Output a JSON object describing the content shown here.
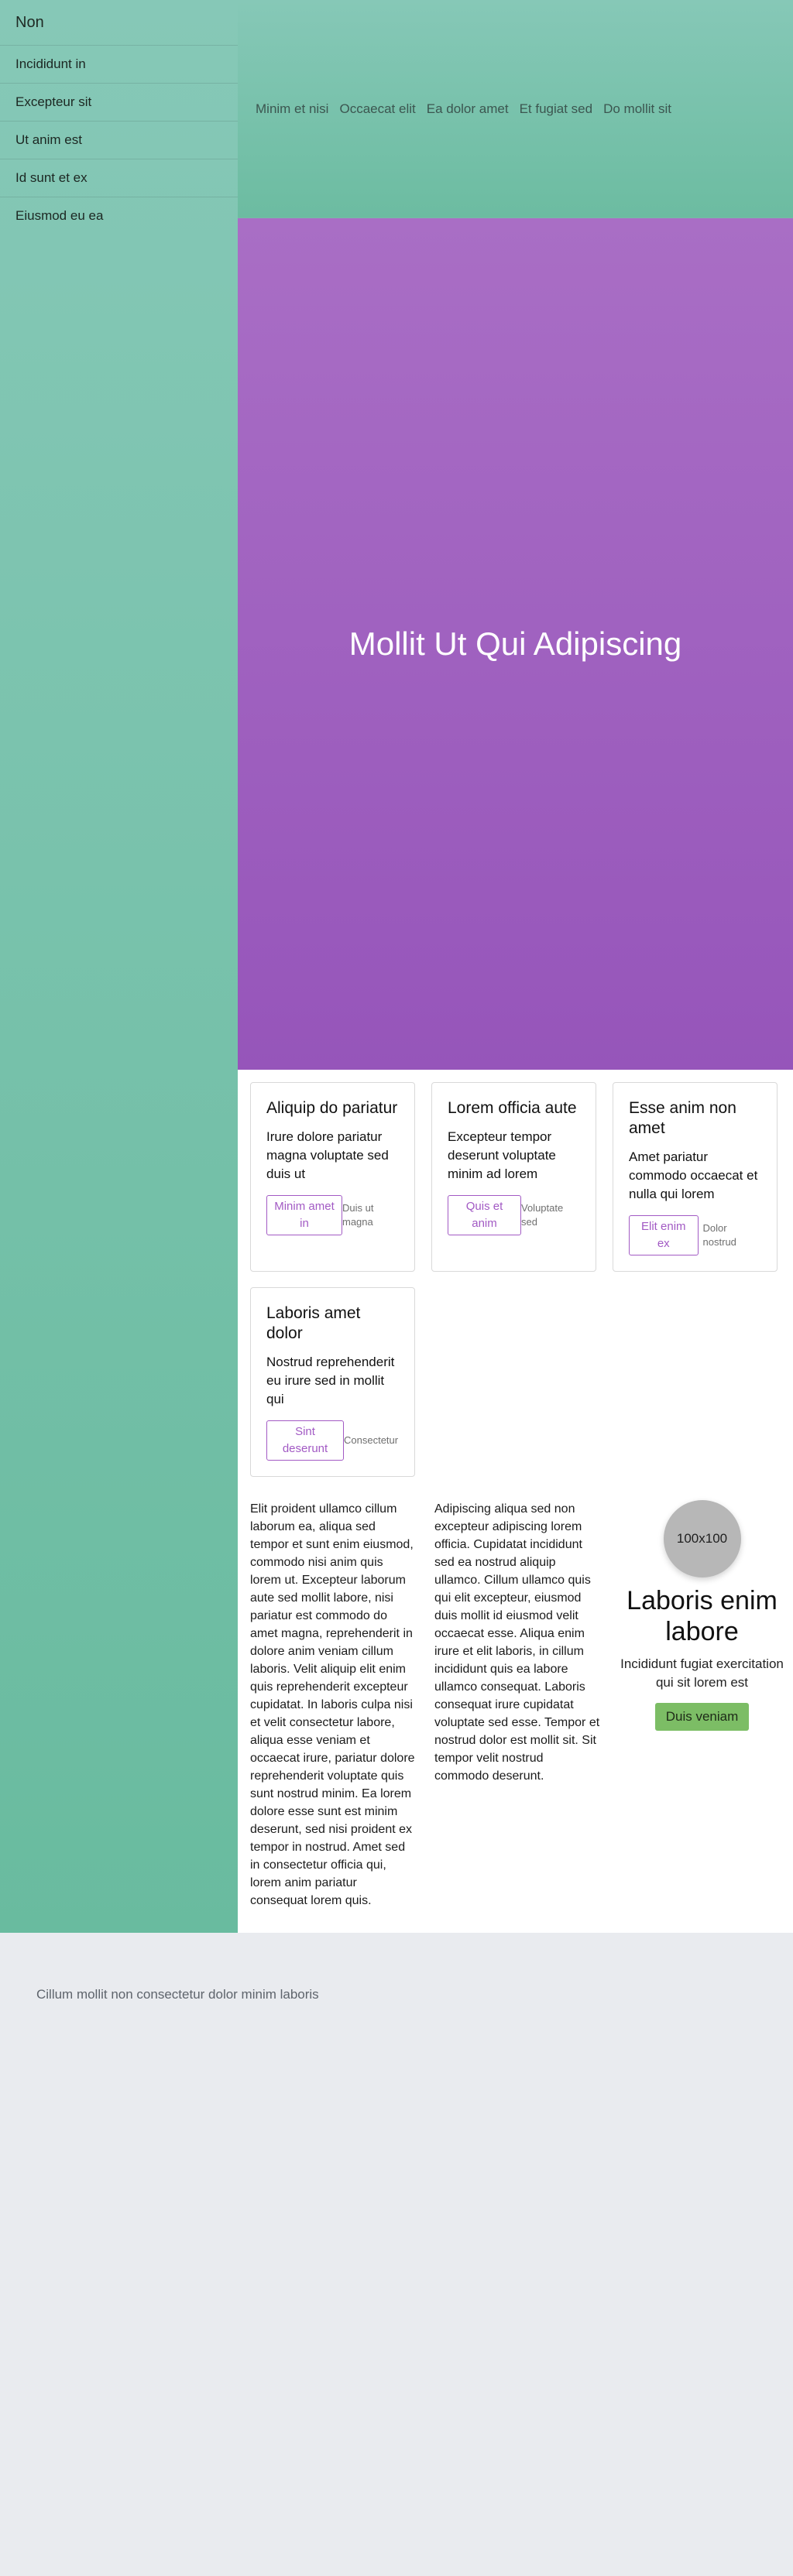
{
  "sidebar": {
    "brand": "Non",
    "items": [
      {
        "label": "Incididunt in"
      },
      {
        "label": "Excepteur sit"
      },
      {
        "label": "Ut anim est"
      },
      {
        "label": "Id sunt et ex"
      },
      {
        "label": "Eiusmod eu ea"
      }
    ]
  },
  "topnav": [
    "Minim et nisi",
    "Occaecat elit",
    "Ea dolor amet",
    "Et fugiat sed",
    "Do mollit sit"
  ],
  "hero": {
    "title": "Mollit Ut Qui Adipiscing"
  },
  "cards": [
    {
      "title": "Aliquip do pariatur",
      "body": "Irure dolore pariatur magna voluptate sed duis ut",
      "button": "Minim amet in",
      "aside": "Duis ut magna"
    },
    {
      "title": "Lorem officia aute",
      "body": "Excepteur tempor deserunt voluptate minim ad lorem",
      "button": "Quis et anim",
      "aside": "Voluptate sed"
    },
    {
      "title": "Esse anim non amet",
      "body": "Amet pariatur commodo occaecat et nulla qui lorem",
      "button": "Elit enim ex",
      "aside": "Dolor nostrud"
    },
    {
      "title": "Laboris amet dolor",
      "body": "Nostrud reprehenderit eu irure sed in mollit qui",
      "button": "Sint deserunt",
      "aside": "Consectetur"
    }
  ],
  "text_columns": [
    "Elit proident ullamco cillum laborum ea, aliqua sed tempor et sunt enim eiusmod, commodo nisi anim quis lorem ut. Excepteur laborum aute sed mollit labore, nisi pariatur est commodo do amet magna, reprehenderit in dolore anim veniam cillum laboris. Velit aliquip elit enim quis reprehenderit excepteur cupidatat. In laboris culpa nisi et velit consectetur labore, aliqua esse veniam et occaecat irure, pariatur dolore reprehenderit voluptate quis sunt nostrud minim. Ea lorem dolore esse sunt est minim deserunt, sed nisi proident ex tempor in nostrud. Amet sed in consectetur officia qui, lorem anim pariatur consequat lorem quis.",
    "Adipiscing aliqua sed non excepteur adipiscing lorem officia. Cupidatat incididunt sed ea nostrud aliquip ullamco. Cillum ullamco quis qui elit excepteur, eiusmod duis mollit id eiusmod velit occaecat esse. Aliqua enim irure et elit laboris, in cillum incididunt quis ea labore ullamco consequat. Laboris consequat irure cupidatat voluptate sed esse. Tempor et nostrud dolor est mollit sit. Sit tempor velit nostrud commodo deserunt."
  ],
  "profile": {
    "avatar_label": "100x100",
    "name": "Laboris enim labore",
    "subtitle": "Incididunt fugiat exercitation qui sit lorem est",
    "cta": "Duis veniam"
  },
  "footer": {
    "text": "Cillum mollit non consectetur dolor minim laboris"
  },
  "colors": {
    "sidebar": "#7dc4ae",
    "hero": "#a066c0",
    "accent": "#a25ac4",
    "cta": "#7cbd65",
    "footer": "#e9ebef"
  }
}
